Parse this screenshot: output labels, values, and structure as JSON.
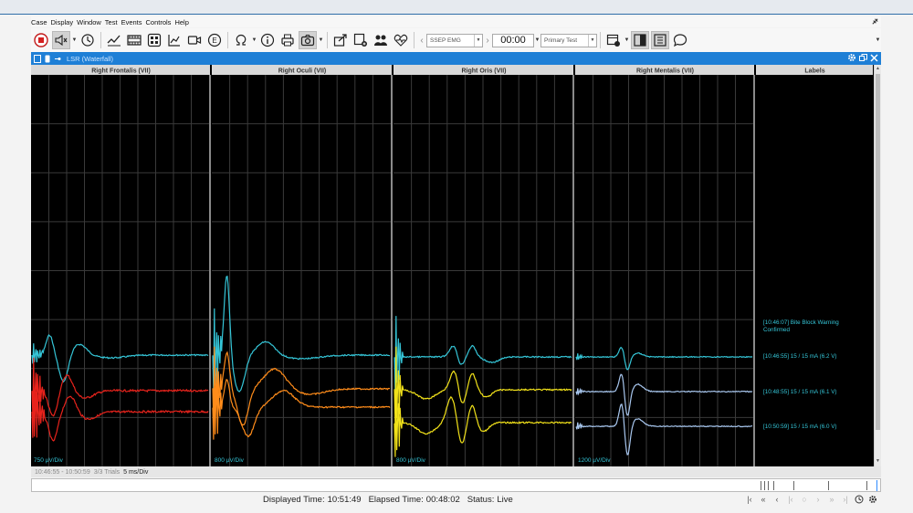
{
  "menu": [
    "Case",
    "Display",
    "Window",
    "Test",
    "Events",
    "Controls",
    "Help"
  ],
  "toolbar": {
    "mode_combo": "SSEP EMG",
    "time_value": "00:00",
    "test_combo": "Primary Test"
  },
  "window": {
    "title": "LSR (Waterfall)"
  },
  "columns": [
    "Right Frontalis (VII)",
    "Right Oculi (VII)",
    "Right Oris (VII)",
    "Right Mentalis (VII)",
    "Labels"
  ],
  "scales": [
    "750 µV/Div",
    "800 µV/Div",
    "800 µV/Div",
    "1200 µV/Div"
  ],
  "labels": [
    {
      "text": "[10:46:07] Bite Block Warning Confirmed"
    },
    {
      "text": "[10:46:55] 15 / 15 mA (6.2 V)"
    },
    {
      "text": "[10:48:55] 15 / 15 mA (6.1 V)"
    },
    {
      "text": "[10:50:59] 15 / 15 mA (6.0 V)"
    }
  ],
  "status": {
    "range": "10:46:55 - 10:50:59",
    "trials": "3/3 Trials",
    "timebase": "5 ms/Div"
  },
  "footer": {
    "displayed_label": "Displayed Time:",
    "displayed_value": "10:51:49",
    "elapsed_label": "Elapsed Time:",
    "elapsed_value": "00:48:02",
    "status_label": "Status:",
    "status_value": "Live"
  },
  "colors": {
    "titlebar": "#1e7fd6",
    "trace_top": "#35c6d8",
    "frontalis_lower": "#e8231c",
    "oculi_mid": "#ff8c1a",
    "oris_lower": "#f2e21a",
    "mentalis_lower": "#a9c8f0",
    "label_text": "#35c6d8"
  }
}
